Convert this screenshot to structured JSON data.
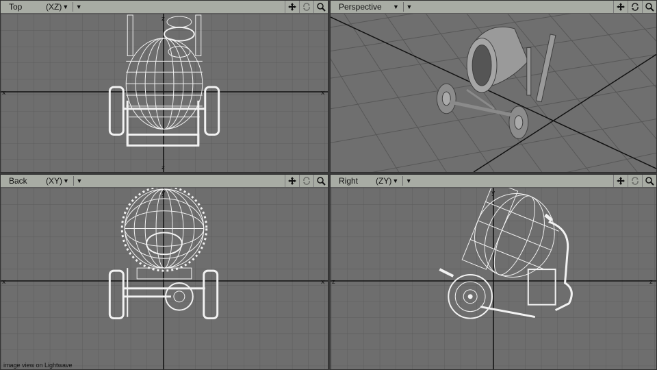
{
  "viewports": {
    "top": {
      "name": "Top",
      "axis": "(XZ)"
    },
    "perspective": {
      "name": "Perspective"
    },
    "back": {
      "name": "Back",
      "axis": "(XY)"
    },
    "right": {
      "name": "Right",
      "axis": "(ZY)"
    }
  },
  "tools": [
    "move-view-icon",
    "rotate-view-icon",
    "zoom-view-icon"
  ],
  "caption": "image view on Lightwave",
  "colors": {
    "toolbar": "#a8aca4",
    "viewport_bg": "#6e6e6e",
    "grid": "#5e5e5e",
    "axis": "#111111",
    "wire": "#f0f0f0"
  }
}
